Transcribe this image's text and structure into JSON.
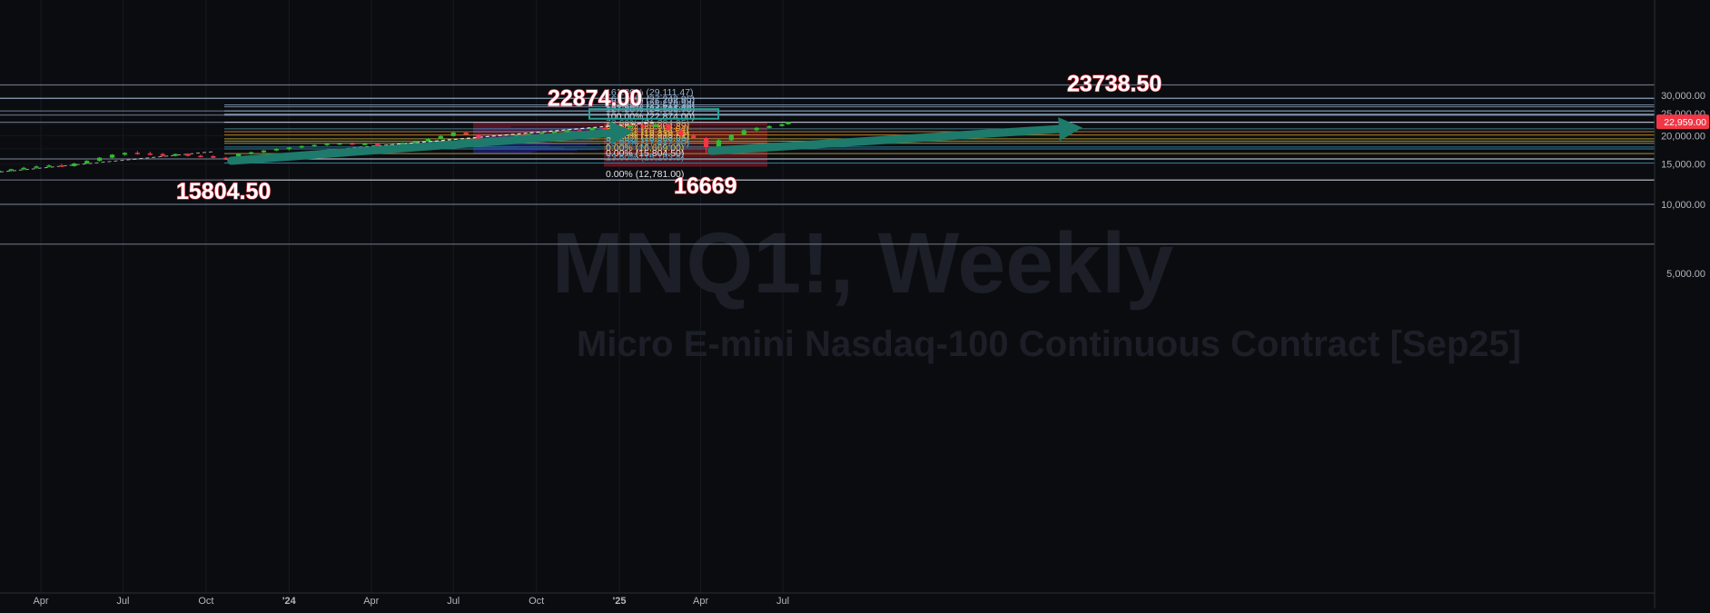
{
  "chart_data": {
    "type": "candlestick",
    "title": "MNQ1!, Weekly",
    "subtitle": "Micro E-mini Nasdaq-100 Continuous Contract [Sep25]",
    "y_axis": {
      "ticks": [
        5000,
        10000,
        15000,
        20000,
        25000,
        30000
      ],
      "tick_labels": [
        "5,000.00",
        "10,000.00",
        "15,000.00",
        "20,000.00",
        "25,000.00",
        "30,000.00"
      ],
      "range": [
        2700,
        33300
      ]
    },
    "x_axis": {
      "labels": [
        "Apr",
        "Jul",
        "Oct",
        "'24",
        "Apr",
        "Jul",
        "Oct",
        "'25",
        "Apr",
        "Jul"
      ],
      "dates": [
        "2023-04-01",
        "2023-07-01",
        "2023-10-01",
        "2024-01-01",
        "2024-04-01",
        "2024-07-01",
        "2024-10-01",
        "2025-01-01",
        "2025-04-01",
        "2025-07-01"
      ]
    },
    "last_price": {
      "value": 22959.0,
      "label": "22,959.00",
      "color": "#f23645"
    },
    "fib_levels": [
      {
        "label": "161.80% (29,111.47)",
        "value": 29111.47,
        "color": "#9ab6d4"
      },
      {
        "label": "161.80% (27,242.95)",
        "value": 27242.95,
        "color": "#9ab6d4"
      },
      {
        "label": "161.80% (26,708.69)",
        "value": 26708.69,
        "color": "#9ab6d4"
      },
      {
        "label": "127.20% (25,619.30)",
        "value": 25619.3,
        "color": "#9ab6d4"
      },
      {
        "label": "127.20% (24,796.90)",
        "value": 24796.9,
        "color": "#9ab6d4"
      },
      {
        "label": "127.20% (24,581.78)",
        "value": 24581.78,
        "color": "#9ab6d4"
      },
      {
        "label": "100.00% (22,874.00)",
        "value": 22874.0,
        "color": "#e0e3eb"
      },
      {
        "label": "78.60% (21,384.95)",
        "value": 21384.95,
        "color": "#5aa0b0"
      },
      {
        "label": "61.80% (20,804.89)",
        "value": 20804.89,
        "color": "#f0a030"
      },
      {
        "label": "61.80% (20,118.64)",
        "value": 20118.64,
        "color": "#f0a030"
      },
      {
        "label": "50.00% (19,339.25)",
        "value": 19339.25,
        "color": "#d4c24a"
      },
      {
        "label": "38.20% (18,916.81)",
        "value": 18916.81,
        "color": "#d4c24a"
      },
      {
        "label": "38.20% (18,503.05)",
        "value": 18503.05,
        "color": "#d4c24a"
      },
      {
        "label": "50.00% (17,827.50)",
        "value": 17827.5,
        "color": "#3c9cc0"
      },
      {
        "label": "23.60% (17,472.50)",
        "value": 17472.5,
        "color": "#3c9cc0"
      },
      {
        "label": "0.00% (16,669.00)",
        "value": 16669.0,
        "color": "#d4c24a"
      },
      {
        "label": "0.00% (15,804.50)",
        "value": 15804.5,
        "color": "#e0e3eb"
      },
      {
        "label": "23.60% (15,163.8)",
        "value": 15163.8,
        "color": "#3c9cc0"
      },
      {
        "label": "0.00% (12,781.00)",
        "value": 12781.0,
        "color": "#e0e3eb"
      }
    ],
    "annotations": [
      {
        "text": "22874.00",
        "value": 22874.0
      },
      {
        "text": "15804.50",
        "value": 15804.5
      },
      {
        "text": "16669",
        "value": 16669
      },
      {
        "text": "23738.50",
        "value": 23738.5
      }
    ],
    "candles": [
      {
        "date": "2023-02-13",
        "o": 13900,
        "h": 14200,
        "l": 13750,
        "c": 14050
      },
      {
        "date": "2023-02-27",
        "o": 14050,
        "h": 14300,
        "l": 13880,
        "c": 14250
      },
      {
        "date": "2023-03-13",
        "o": 14250,
        "h": 14600,
        "l": 14100,
        "c": 14450
      },
      {
        "date": "2023-03-27",
        "o": 14450,
        "h": 14800,
        "l": 14300,
        "c": 14650
      },
      {
        "date": "2023-04-10",
        "o": 14650,
        "h": 14950,
        "l": 14500,
        "c": 14800
      },
      {
        "date": "2023-04-24",
        "o": 14800,
        "h": 15050,
        "l": 14550,
        "c": 14700
      },
      {
        "date": "2023-05-08",
        "o": 14700,
        "h": 15200,
        "l": 14600,
        "c": 15100
      },
      {
        "date": "2023-05-22",
        "o": 15100,
        "h": 15600,
        "l": 15000,
        "c": 15500
      },
      {
        "date": "2023-06-05",
        "o": 15500,
        "h": 16100,
        "l": 15400,
        "c": 16000
      },
      {
        "date": "2023-06-19",
        "o": 16000,
        "h": 16600,
        "l": 15900,
        "c": 16500
      },
      {
        "date": "2023-07-03",
        "o": 16500,
        "h": 16900,
        "l": 16300,
        "c": 16800
      },
      {
        "date": "2023-07-17",
        "o": 16800,
        "h": 17100,
        "l": 16500,
        "c": 16700
      },
      {
        "date": "2023-07-31",
        "o": 16700,
        "h": 17000,
        "l": 16400,
        "c": 16600
      },
      {
        "date": "2023-08-14",
        "o": 16600,
        "h": 16800,
        "l": 16100,
        "c": 16300
      },
      {
        "date": "2023-08-28",
        "o": 16300,
        "h": 16700,
        "l": 16200,
        "c": 16600
      },
      {
        "date": "2023-09-11",
        "o": 16600,
        "h": 16750,
        "l": 16200,
        "c": 16300
      },
      {
        "date": "2023-09-25",
        "o": 16300,
        "h": 16500,
        "l": 16050,
        "c": 16250
      },
      {
        "date": "2023-10-09",
        "o": 16250,
        "h": 16400,
        "l": 15900,
        "c": 16000
      },
      {
        "date": "2023-10-23",
        "o": 16000,
        "h": 16150,
        "l": 15804.5,
        "c": 15900
      },
      {
        "date": "2023-11-06",
        "o": 15900,
        "h": 16700,
        "l": 15850,
        "c": 16600
      },
      {
        "date": "2023-11-20",
        "o": 16600,
        "h": 17000,
        "l": 16500,
        "c": 16900
      },
      {
        "date": "2023-12-04",
        "o": 16900,
        "h": 17300,
        "l": 16800,
        "c": 17200
      },
      {
        "date": "2023-12-18",
        "o": 17200,
        "h": 17600,
        "l": 17100,
        "c": 17500
      },
      {
        "date": "2024-01-01",
        "o": 17500,
        "h": 17800,
        "l": 17200,
        "c": 17700
      },
      {
        "date": "2024-01-15",
        "o": 17700,
        "h": 18100,
        "l": 17600,
        "c": 18000
      },
      {
        "date": "2024-01-29",
        "o": 18000,
        "h": 18300,
        "l": 17900,
        "c": 18200
      },
      {
        "date": "2024-02-12",
        "o": 18200,
        "h": 18500,
        "l": 18000,
        "c": 18400
      },
      {
        "date": "2024-02-26",
        "o": 18400,
        "h": 18600,
        "l": 18200,
        "c": 18500
      },
      {
        "date": "2024-03-11",
        "o": 18500,
        "h": 18700,
        "l": 18200,
        "c": 18300
      },
      {
        "date": "2024-03-25",
        "o": 18300,
        "h": 18600,
        "l": 18100,
        "c": 18400
      },
      {
        "date": "2024-04-08",
        "o": 18400,
        "h": 18500,
        "l": 17700,
        "c": 17900
      },
      {
        "date": "2024-04-22",
        "o": 17900,
        "h": 18300,
        "l": 17800,
        "c": 18200
      },
      {
        "date": "2024-05-06",
        "o": 18200,
        "h": 18700,
        "l": 18100,
        "c": 18600
      },
      {
        "date": "2024-05-20",
        "o": 18600,
        "h": 19000,
        "l": 18500,
        "c": 18900
      },
      {
        "date": "2024-06-03",
        "o": 18900,
        "h": 19500,
        "l": 18800,
        "c": 19400
      },
      {
        "date": "2024-06-17",
        "o": 19400,
        "h": 20100,
        "l": 19300,
        "c": 19900
      },
      {
        "date": "2024-07-01",
        "o": 19900,
        "h": 20700,
        "l": 19800,
        "c": 20600
      },
      {
        "date": "2024-07-15",
        "o": 20600,
        "h": 20900,
        "l": 20000,
        "c": 20200
      },
      {
        "date": "2024-07-29",
        "o": 20200,
        "h": 20300,
        "l": 18800,
        "c": 19000
      },
      {
        "date": "2024-08-12",
        "o": 19000,
        "h": 19700,
        "l": 18400,
        "c": 19600
      },
      {
        "date": "2024-08-26",
        "o": 19600,
        "h": 20000,
        "l": 19200,
        "c": 19500
      },
      {
        "date": "2024-09-09",
        "o": 19500,
        "h": 20200,
        "l": 19300,
        "c": 20100
      },
      {
        "date": "2024-09-23",
        "o": 20100,
        "h": 20400,
        "l": 19900,
        "c": 20300
      },
      {
        "date": "2024-10-07",
        "o": 20300,
        "h": 20700,
        "l": 20100,
        "c": 20600
      },
      {
        "date": "2024-10-21",
        "o": 20600,
        "h": 20900,
        "l": 20400,
        "c": 20700
      },
      {
        "date": "2024-11-04",
        "o": 20700,
        "h": 21300,
        "l": 20300,
        "c": 21100
      },
      {
        "date": "2024-11-18",
        "o": 21100,
        "h": 21300,
        "l": 20600,
        "c": 20900
      },
      {
        "date": "2024-12-02",
        "o": 20900,
        "h": 21700,
        "l": 20800,
        "c": 21600
      },
      {
        "date": "2024-12-16",
        "o": 21600,
        "h": 22200,
        "l": 21200,
        "c": 21400
      },
      {
        "date": "2024-12-30",
        "o": 21400,
        "h": 21900,
        "l": 21000,
        "c": 21700
      },
      {
        "date": "2025-01-13",
        "o": 21700,
        "h": 22200,
        "l": 21300,
        "c": 22100
      },
      {
        "date": "2025-01-27",
        "o": 22100,
        "h": 22400,
        "l": 21400,
        "c": 21800
      },
      {
        "date": "2025-02-10",
        "o": 21800,
        "h": 22874,
        "l": 21700,
        "c": 22400
      },
      {
        "date": "2025-02-24",
        "o": 22400,
        "h": 22500,
        "l": 21000,
        "c": 21100
      },
      {
        "date": "2025-03-10",
        "o": 21100,
        "h": 21300,
        "l": 19900,
        "c": 20000
      },
      {
        "date": "2025-03-24",
        "o": 20000,
        "h": 20400,
        "l": 19300,
        "c": 19500
      },
      {
        "date": "2025-04-07",
        "o": 19500,
        "h": 19700,
        "l": 16669,
        "c": 17800
      },
      {
        "date": "2025-04-21",
        "o": 17800,
        "h": 19300,
        "l": 17500,
        "c": 19100
      },
      {
        "date": "2025-05-05",
        "o": 19100,
        "h": 20300,
        "l": 18900,
        "c": 20200
      },
      {
        "date": "2025-05-19",
        "o": 20200,
        "h": 21300,
        "l": 20000,
        "c": 21100
      },
      {
        "date": "2025-06-02",
        "o": 21100,
        "h": 21800,
        "l": 20900,
        "c": 21600
      },
      {
        "date": "2025-06-16",
        "o": 21600,
        "h": 22200,
        "l": 21500,
        "c": 22000
      },
      {
        "date": "2025-06-30",
        "o": 22000,
        "h": 22600,
        "l": 21900,
        "c": 22400
      },
      {
        "date": "2025-07-07",
        "o": 22400,
        "h": 23000,
        "l": 22300,
        "c": 22959
      }
    ],
    "colors": {
      "background": "#0b0c10",
      "up": "#2ebd2e",
      "down": "#f23645",
      "trend_arrow": "#1e7a6a",
      "axis_line": "#2a2e39"
    }
  }
}
